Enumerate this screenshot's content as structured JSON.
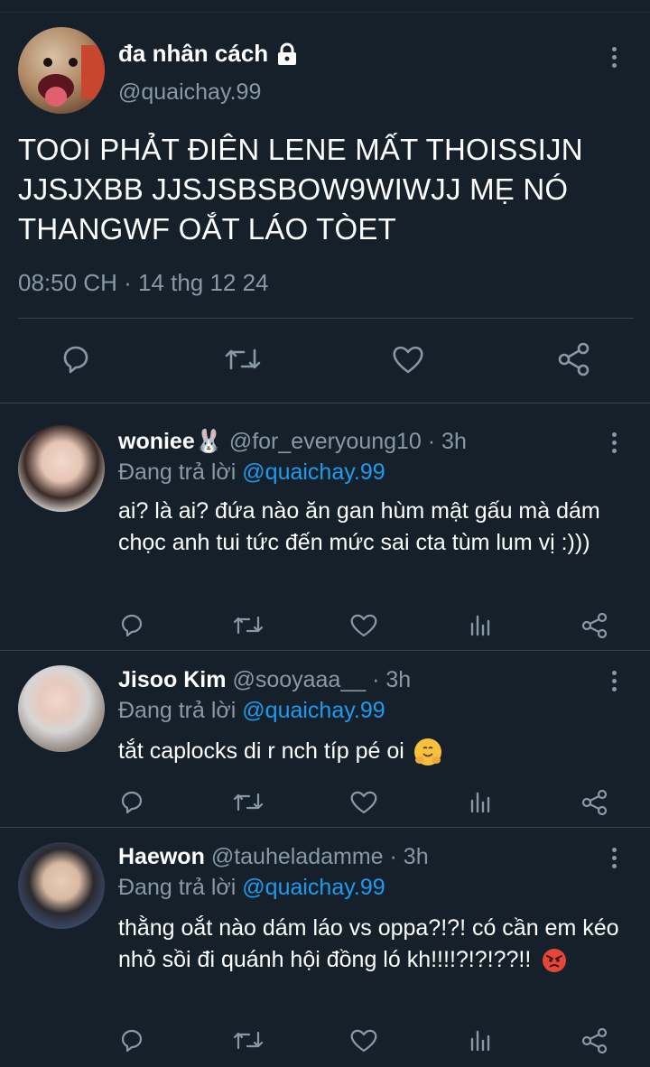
{
  "colors": {
    "background": "#15202b",
    "text_primary": "#ffffff",
    "text_secondary": "#8899a6",
    "divider": "#38444d",
    "mention": "#1d9bf0"
  },
  "main_tweet": {
    "display_name": "đa nhân cách",
    "handle": "@quaichay.99",
    "text": "TOOI PHẢT ĐIÊN LENE MẤT THOISSIJN JJSJXBB JJSJSBSBOW9WIWJJ MẸ NÓ THANGWF OẮT LÁO TÒET",
    "timestamp": "08:50 CH · 14 thg 12 24",
    "icons": [
      "lock-icon",
      "more-icon",
      "reply-icon",
      "retweet-icon",
      "like-icon",
      "share-icon"
    ]
  },
  "replies": [
    {
      "display_name": "woniee🐰",
      "handle_time": "@for_everyoung10 · 3h",
      "replying_prefix": "Đang trả lời ",
      "replying_to": "@quaichay.99",
      "text": "ai? là ai? đứa nào ăn gan hùm mật gấu mà dám chọc anh tui tức đến mức sai cta tùm lum vị :)))"
    },
    {
      "display_name": "Jisoo Kim",
      "handle_time": "@sooyaaa__ · 3h",
      "replying_prefix": "Đang trả lời ",
      "replying_to": "@quaichay.99",
      "text": "tắt caplocks di r nch típ pé oi",
      "emoji": "hugging-face-emoji"
    },
    {
      "display_name": "Haewon",
      "handle_time": "@tauheladamme · 3h",
      "replying_prefix": "Đang trả lời ",
      "replying_to": "@quaichay.99",
      "text": "thằng oắt nào dám láo vs oppa?!?! có cần em kéo nhỏ sồi đi quánh hội đồng ló kh!!!!?!?!??!!",
      "emoji": "angry-face-emoji"
    }
  ]
}
